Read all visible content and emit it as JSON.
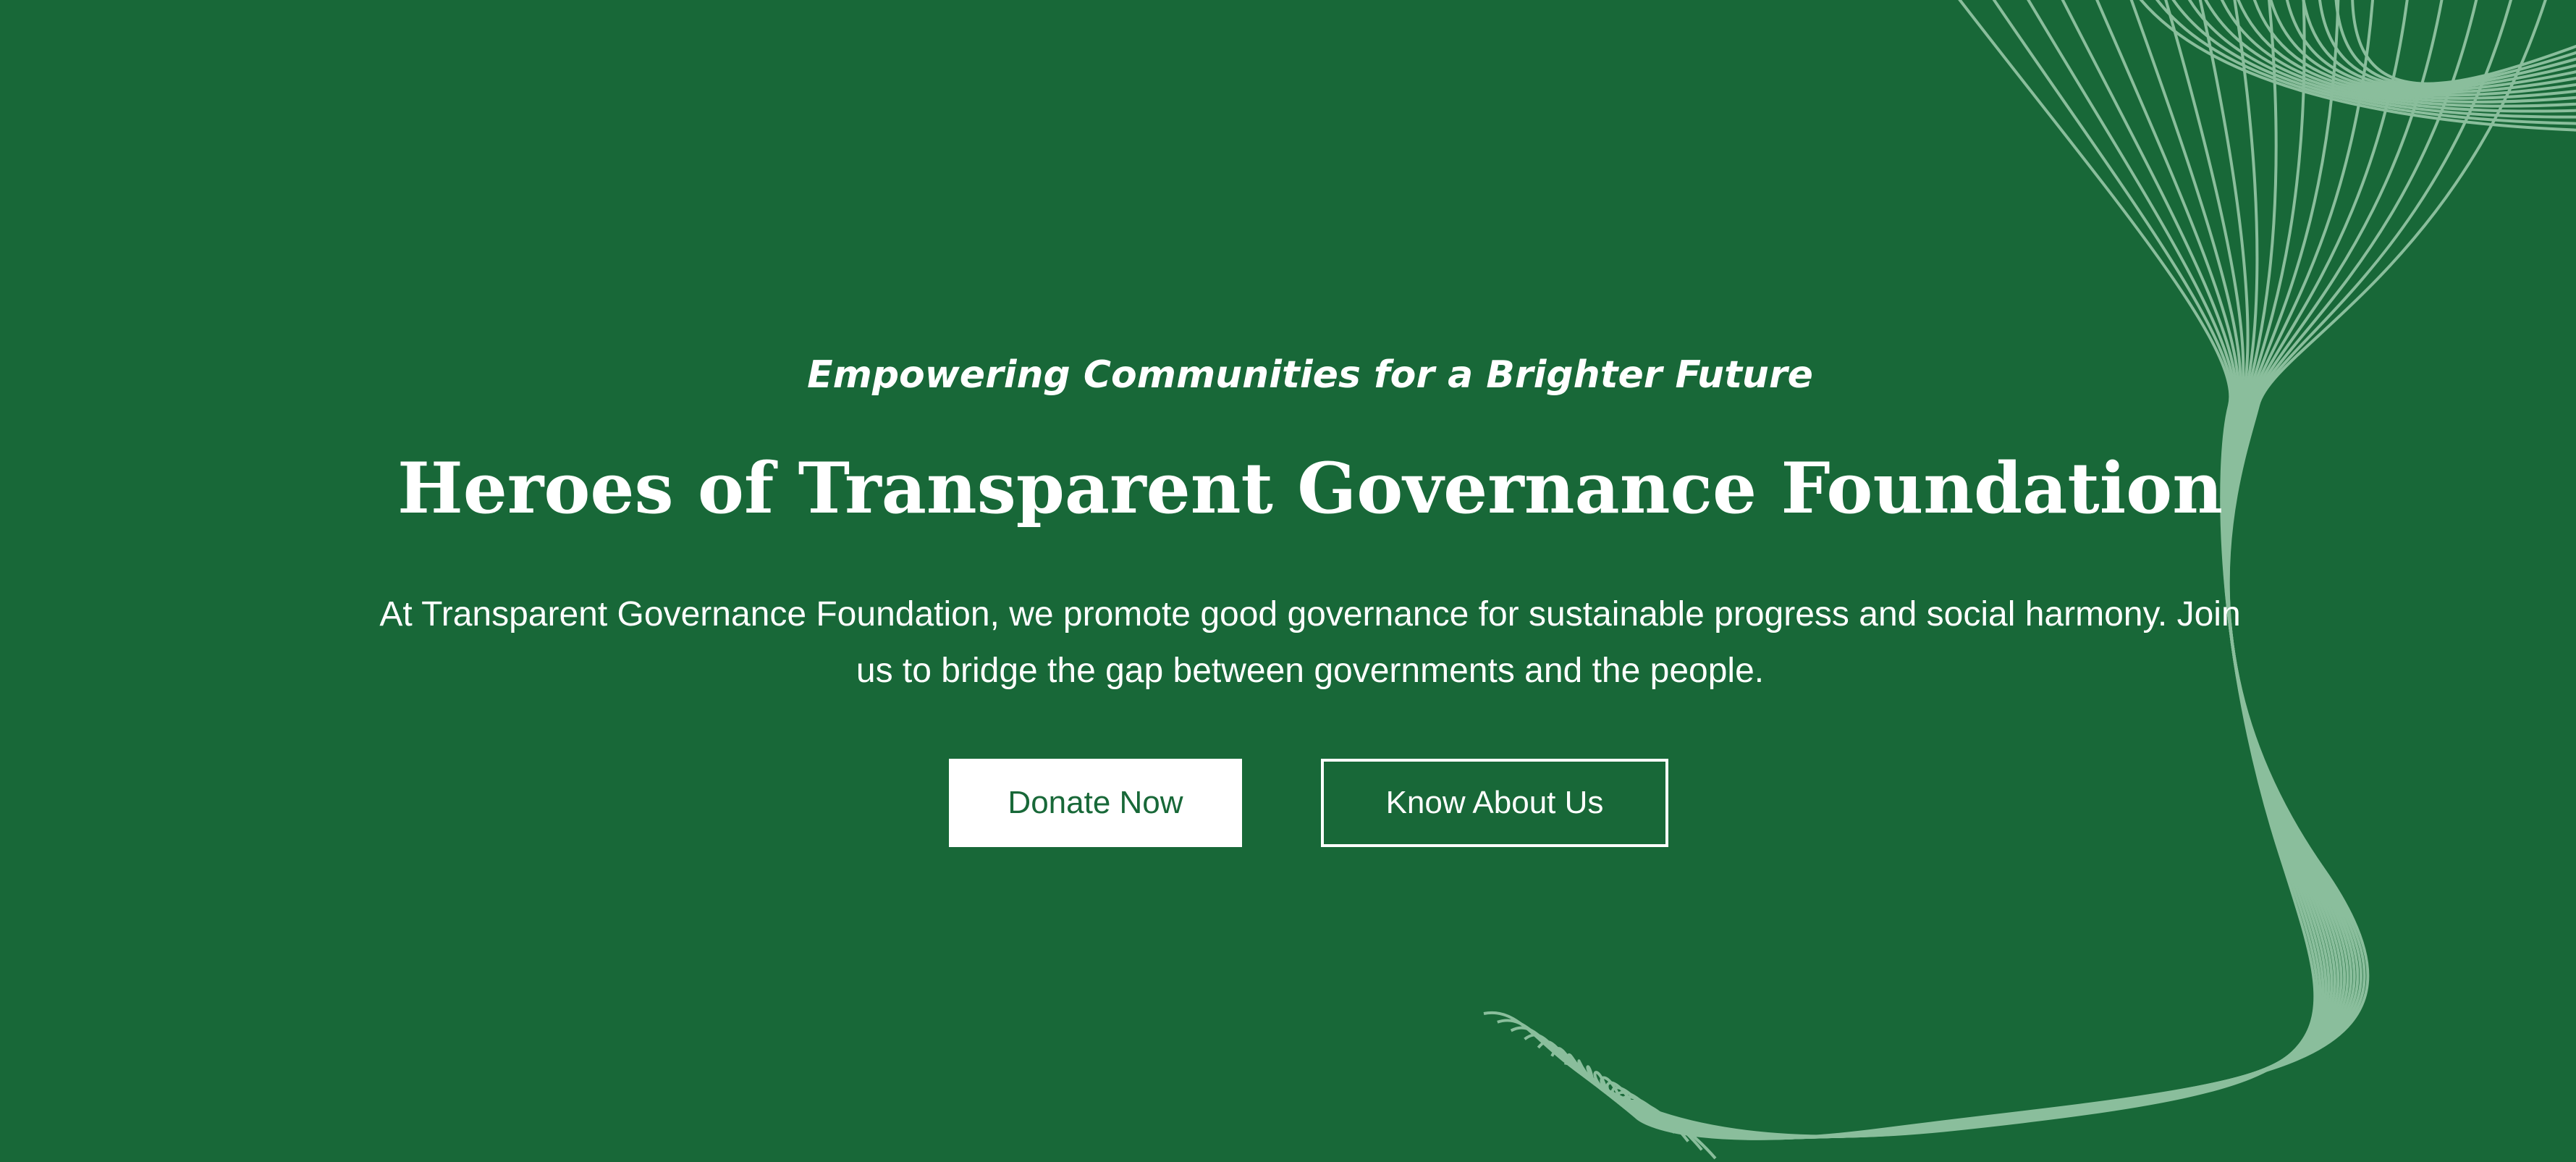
{
  "hero": {
    "tagline": "Empowering Communities for a Brighter Future",
    "title": "Heroes of Transparent Governance Foundation",
    "description": "At Transparent Governance Foundation, we promote good governance for sustainable progress and social harmony. Join us to bridge the gap between governments and the people.",
    "primary_button_label": "Donate Now",
    "secondary_button_label": "Know About Us"
  },
  "colors": {
    "background": "#186838",
    "text": "#ffffff",
    "wave_lines": "#9fceae"
  },
  "decoration": {
    "icon": "wave-lines-graphic"
  }
}
